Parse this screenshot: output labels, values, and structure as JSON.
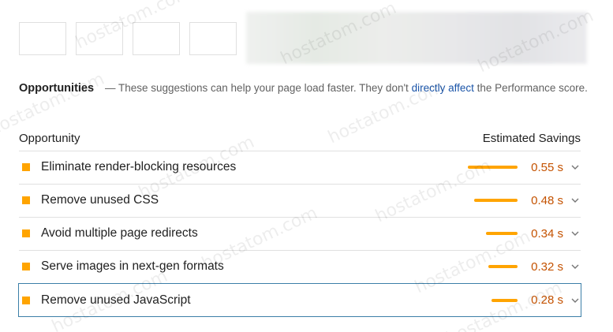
{
  "header": {
    "title": "Opportunities",
    "description_prefix": "— These suggestions can help your page load faster. They don't",
    "link_text": "directly affect",
    "description_suffix": "the Performance score."
  },
  "columns": {
    "opportunity": "Opportunity",
    "savings": "Estimated Savings"
  },
  "audits": [
    {
      "title": "Eliminate render-blocking resources",
      "savings": "0.55 s",
      "savings_seconds": 0.55
    },
    {
      "title": "Remove unused CSS",
      "savings": "0.48 s",
      "savings_seconds": 0.48
    },
    {
      "title": "Avoid multiple page redirects",
      "savings": "0.34 s",
      "savings_seconds": 0.34
    },
    {
      "title": "Serve images in next-gen formats",
      "savings": "0.32 s",
      "savings_seconds": 0.32
    },
    {
      "title": "Remove unused JavaScript",
      "savings": "0.28 s",
      "savings_seconds": 0.28
    }
  ],
  "watermark": "hostatom.com",
  "colors": {
    "fail": "#ffa400",
    "savings_text": "#c45200",
    "link": "#1a54a8",
    "focus_border": "#3c7fa8"
  }
}
